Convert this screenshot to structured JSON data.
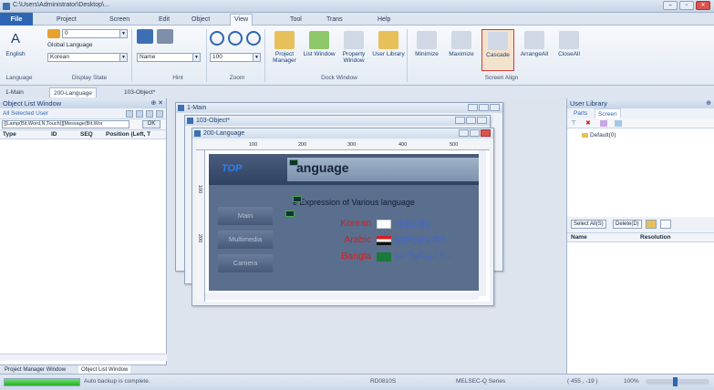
{
  "window": {
    "title": "C:\\Users\\Administrator\\Desktop\\..."
  },
  "window_buttons": [
    "minimize",
    "maximize",
    "close"
  ],
  "ribbon_tabs": [
    {
      "label": "File"
    },
    {
      "label": "Project"
    },
    {
      "label": "Screen"
    },
    {
      "label": "Edit"
    },
    {
      "label": "Object"
    },
    {
      "label": "View"
    },
    {
      "label": "Tool"
    },
    {
      "label": "Trans"
    },
    {
      "label": "Help"
    }
  ],
  "ribbon": {
    "language_btn": "English",
    "global_language": "Global Language",
    "language_combo": "Korean",
    "state_combo": "0",
    "hint_combo": "Name",
    "zoom_combo": "100",
    "groups": {
      "language": "Language",
      "display_state": "Display State",
      "hint": "Hint",
      "zoom": "Zoom",
      "dock": "Dock Window",
      "align": "Screen Align"
    },
    "dock_buttons": [
      "Project Manager",
      "List Window",
      "Property Window",
      "User Library"
    ],
    "align_buttons": [
      "Minimize",
      "Maximize",
      "Cascade",
      "ArrangeAll",
      "CloseAll"
    ]
  },
  "doc_tabs": [
    "1-Main",
    "200-Language",
    "103-Object*"
  ],
  "left_panel": {
    "title": "Object List Window",
    "filter_tabs": "All  Selected  User",
    "filter_input": "{[Lamp(Bit,Word,N,Touch)][Message(Bit,Wor",
    "ok": "OK",
    "columns": [
      "Type",
      "ID",
      "SEQ",
      "Position (Left, T"
    ],
    "bottom_tabs": [
      "Project Manager Window",
      "Object List Window"
    ]
  },
  "mdi": {
    "win1": "1-Main",
    "win2": "103-Object*",
    "win3": "200-Language",
    "ruler": [
      "100",
      "200",
      "300",
      "400",
      "500"
    ],
    "vruler": [
      "100",
      "200"
    ]
  },
  "screen": {
    "logo": "TOP",
    "title": "anguage",
    "subtitle": "e Expression of Various language",
    "menu": [
      "Main",
      "Multimedia",
      "Camera"
    ],
    "rows": [
      {
        "lang": "Korean",
        "native": "니코드에 ["
      },
      {
        "lang": "Arabic",
        "native": "ইউনিকোড কী?"
      },
      {
        "lang": "Bangla",
        "native": "ے ؟ \"یونیکوڈ\" ندة"
      }
    ]
  },
  "right_panel": {
    "title": "User Library",
    "tabs": [
      "Parts",
      "Screen"
    ],
    "tree_item": "Default(0)",
    "select_all": "Select All(S)",
    "delete": "Delete(D)",
    "columns": [
      "Name",
      "Resolution"
    ]
  },
  "status": {
    "progress": 1.0,
    "message": "Auto backup is complete.",
    "device": "RD0810S",
    "series": "MELSEC-Q Series",
    "coords": "( 455 , -19 )",
    "zoom": "100%"
  },
  "colors": {
    "accent": "#2f66b3",
    "highlight": "#d43a3a",
    "canvas": "#5a6e8e"
  }
}
